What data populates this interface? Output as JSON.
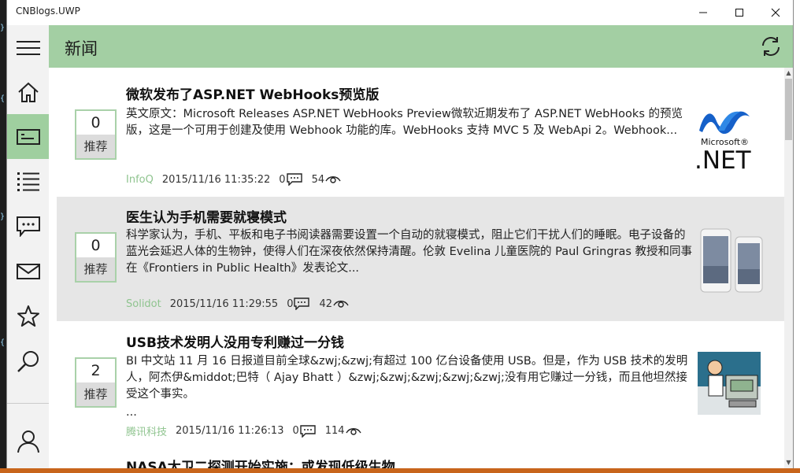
{
  "window": {
    "title": "CNBlogs.UWP"
  },
  "header": {
    "title": "新闻"
  },
  "sidebar": {
    "items": [
      {
        "name": "menu-icon"
      },
      {
        "name": "home-icon"
      },
      {
        "name": "news-icon"
      },
      {
        "name": "list-icon"
      },
      {
        "name": "comment-icon"
      },
      {
        "name": "mail-icon"
      },
      {
        "name": "star-icon"
      },
      {
        "name": "search-icon"
      },
      {
        "name": "user-icon"
      }
    ]
  },
  "vote_label": "推荐",
  "news": [
    {
      "title": "微软发布了ASP.NET WebHooks预览版",
      "votes": "0",
      "summary": "英文原文：Microsoft Releases ASP.NET WebHooks Preview微软近期发布了 ASP.NET WebHooks 的预览版，这是一个可用于创建及使用 Webhook 功能的库。WebHooks 支持 MVC 5 及 WebApi 2。Webhook...",
      "source": "InfoQ",
      "date": "2015/11/16 11:35:22",
      "comments": "0",
      "views": "54",
      "thumb_text_top": "Microsoft®",
      "thumb_text_bottom": ".NET"
    },
    {
      "title": "医生认为手机需要就寝模式",
      "votes": "0",
      "summary": "科学家认为，手机、平板和电子书阅读器需要设置一个自动的就寝模式，阻止它们干扰人们的睡眠。电子设备的蓝光会延迟人体的生物钟，使得人们在深夜依然保持清醒。伦敦 Evelina 儿童医院的 Paul Gringras 教授和同事在《Frontiers in Public Health》发表论文...",
      "source": "Solidot",
      "date": "2015/11/16 11:29:55",
      "comments": "0",
      "views": "42"
    },
    {
      "title": "USB技术发明人没用专利赚过一分钱",
      "votes": "2",
      "summary": "BI 中文站 11 月 16 日报道目前全球&zwj;&zwj;有超过 100 亿台设备使用 USB。但是，作为 USB 技术的发明人，阿杰伊&middot;巴特（ Ajay Bhatt ）&zwj;&zwj;&zwj;&zwj;&zwj;没有用它赚过一分钱，而且他坦然接受这个事实。",
      "summary_more": "...",
      "source": "腾讯科技",
      "date": "2015/11/16 11:26:13",
      "comments": "0",
      "views": "114"
    },
    {
      "title": "NASA太卫二探测开始实施：或发现低级生物"
    }
  ]
}
